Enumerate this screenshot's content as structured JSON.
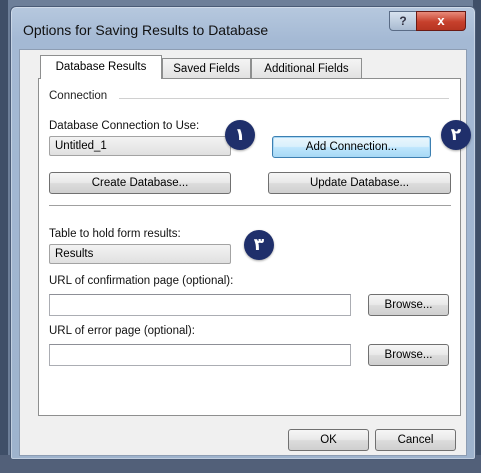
{
  "window": {
    "title": "Options for Saving Results to Database",
    "help_glyph": "?",
    "close_glyph": "x"
  },
  "tabs": [
    {
      "label": "Database Results",
      "active": true
    },
    {
      "label": "Saved Fields",
      "active": false
    },
    {
      "label": "Additional Fields",
      "active": false
    }
  ],
  "connection": {
    "group_label": "Connection",
    "db_label": "Database Connection to Use:",
    "db_value": "Untitled_1",
    "add_connection": "Add Connection...",
    "create_database": "Create Database...",
    "update_database": "Update Database..."
  },
  "results": {
    "table_label": "Table to hold form results:",
    "table_value": "Results",
    "confirm_label": "URL of confirmation page (optional):",
    "confirm_value": "",
    "error_label": "URL of error page (optional):",
    "error_value": "",
    "browse": "Browse..."
  },
  "footer": {
    "ok": "OK",
    "cancel": "Cancel"
  },
  "annotations": [
    "١",
    "٢",
    "٣"
  ],
  "colors": {
    "badge": "#1f2f6b",
    "focus_button": "#bee6fd",
    "close_button": "#c6402c"
  }
}
